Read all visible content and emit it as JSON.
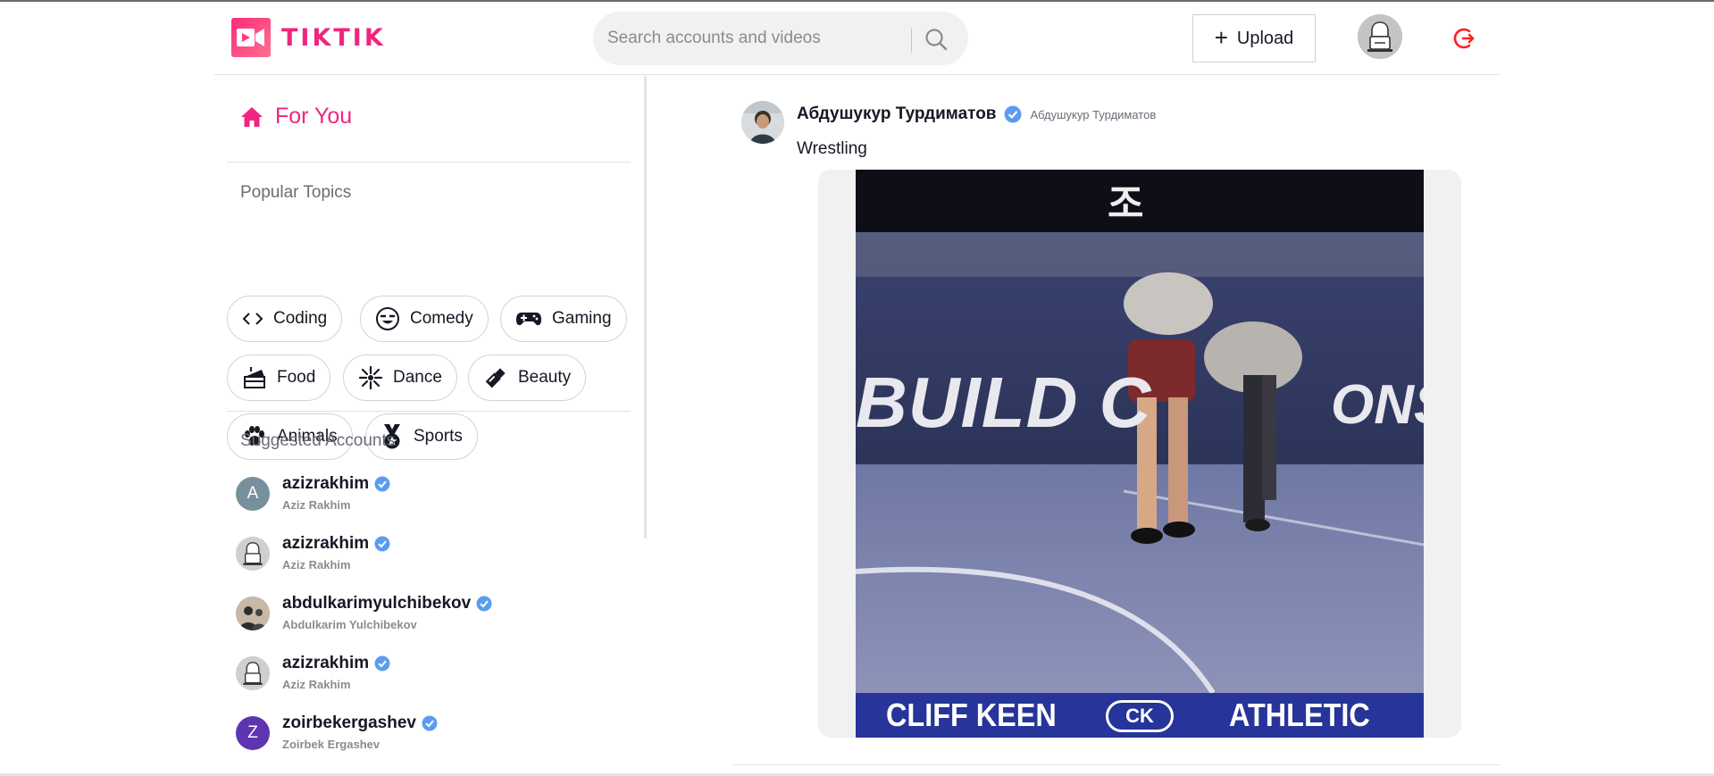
{
  "header": {
    "logo_text": "TIKTIK",
    "search_placeholder": "Search accounts and videos",
    "upload_label": "Upload",
    "brand_color": "#f0257f",
    "logout_color": "#ff1f1f"
  },
  "sidebar": {
    "for_you_label": "For You",
    "popular_topics_title": "Popular Topics",
    "topics": [
      {
        "label": "Coding",
        "icon": "code-icon"
      },
      {
        "label": "Comedy",
        "icon": "laughing-face-icon"
      },
      {
        "label": "Gaming",
        "icon": "gamepad-icon"
      },
      {
        "label": "Food",
        "icon": "cake-icon"
      },
      {
        "label": "Dance",
        "icon": "disco-ball-icon"
      },
      {
        "label": "Beauty",
        "icon": "lipstick-icon"
      },
      {
        "label": "Animals",
        "icon": "paw-icon"
      },
      {
        "label": "Sports",
        "icon": "medal-icon"
      }
    ],
    "suggested_title": "Suggested Accounts",
    "accounts": [
      {
        "username": "azizrakhim",
        "name": "Aziz Rakhim",
        "avatar_letter": "A",
        "avatar_color": "#78909c"
      },
      {
        "username": "azizrakhim",
        "name": "Aziz Rakhim",
        "avatar_letter": "",
        "avatar_color": "#cfcfcf"
      },
      {
        "username": "abdulkarimyulchibekov",
        "name": "Abdulkarim Yulchibekov",
        "avatar_letter": "",
        "avatar_color": "#b9a99a"
      },
      {
        "username": "azizrakhim",
        "name": "Aziz Rakhim",
        "avatar_letter": "",
        "avatar_color": "#cfcfcf"
      },
      {
        "username": "zoirbekergashev",
        "name": "Zoirbek Ergashev",
        "avatar_letter": "Z",
        "avatar_color": "#5e35b1"
      }
    ]
  },
  "post": {
    "author": "Абдушукур Турдиматов",
    "handle": "Абдушукур Турдиматов",
    "caption": "Wrestling",
    "video_texts": {
      "banner_left": "BUILD C",
      "banner_right": "ONS",
      "footer_left": "CLIFF KEEN",
      "footer_logo": "CK",
      "footer_right": "ATHLETIC",
      "top_char": "조"
    }
  },
  "colors": {
    "verified": "#20d5ec",
    "verified_badge": "#5b9cf0",
    "text": "#161823",
    "muted": "#8a8b91"
  }
}
